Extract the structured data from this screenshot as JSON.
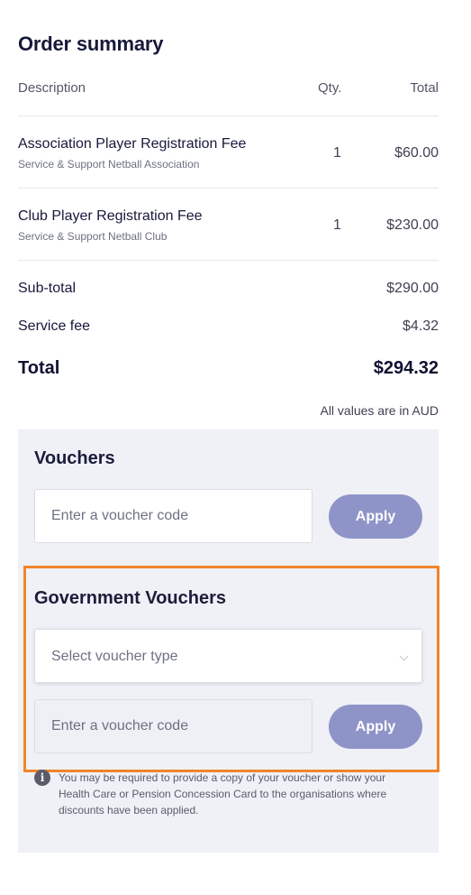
{
  "order": {
    "title": "Order summary",
    "headers": {
      "description": "Description",
      "qty": "Qty.",
      "total": "Total"
    },
    "items": [
      {
        "name": "Association Player Registration Fee",
        "org": "Service & Support Netball Association",
        "qty": "1",
        "total": "$60.00"
      },
      {
        "name": "Club Player Registration Fee",
        "org": "Service & Support Netball Club",
        "qty": "1",
        "total": "$230.00"
      }
    ],
    "subtotal_label": "Sub-total",
    "subtotal_value": "$290.00",
    "service_fee_label": "Service fee",
    "service_fee_value": "$4.32",
    "total_label": "Total",
    "total_value": "$294.32",
    "currency_note": "All values are in AUD"
  },
  "vouchers": {
    "heading": "Vouchers",
    "code_placeholder": "Enter a voucher code",
    "apply_label": "Apply"
  },
  "gov_vouchers": {
    "heading": "Government Vouchers",
    "select_placeholder": "Select voucher type",
    "code_placeholder": "Enter a voucher code",
    "apply_label": "Apply",
    "info_icon_glyph": "i",
    "info_text": "You may be required to provide a copy of your voucher or show your Health Care or Pension Concession Card to the organisations where discounts have been applied."
  },
  "colors": {
    "accent_button": "#8e94c8",
    "highlight_border": "#f1842a",
    "panel_bg": "#eff1f7"
  }
}
